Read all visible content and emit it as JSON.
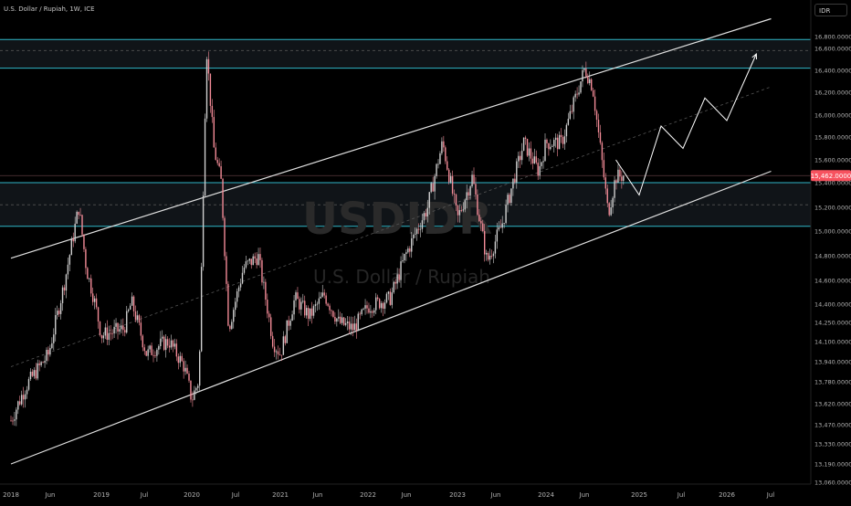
{
  "header": {
    "symbol_line": "U.S. Dollar / Rupiah, 1W, ICE",
    "currency": "IDR"
  },
  "watermark": {
    "ticker": "USDIDR",
    "name": "U.S. Dollar / Rupiah"
  },
  "price_tag": {
    "value": "15,462.0000",
    "color": "#f7525f"
  },
  "colors": {
    "up": "#cfcfcf",
    "down": "#f38b97",
    "zone_line": "#2fb6c8",
    "channel": "#e0e0e0",
    "axis_text": "#b3b3b3"
  },
  "chart_data": {
    "type": "candlestick",
    "title": "U.S. Dollar / Rupiah, 1W, ICE",
    "y_unit": "IDR",
    "y_ticks": [
      "16,800.0000",
      "16,600.0000",
      "16,400.0000",
      "16,200.0000",
      "16,000.0000",
      "15,800.0000",
      "15,600.0000",
      "15,400.0000",
      "15,200.0000",
      "15,000.0000",
      "14,800.0000",
      "14,600.0000",
      "14,400.0000",
      "14,250.0000",
      "14,100.0000",
      "13,940.0000",
      "13,780.0000",
      "13,620.0000",
      "13,470.0000",
      "13,330.0000",
      "13,190.0000",
      "13,060.0000"
    ],
    "x_ticks": [
      "2018",
      "Jun",
      "2019",
      "Jul",
      "2020",
      "Jul",
      "2021",
      "Jun",
      "2022",
      "Jun",
      "2023",
      "Jun",
      "2024",
      "Jun",
      "2025",
      "Jul",
      "2026",
      "Jul"
    ],
    "price_path": [
      [
        "2018-01",
        13500
      ],
      [
        "2018-03",
        13750
      ],
      [
        "2018-06",
        14000
      ],
      [
        "2018-08",
        14550
      ],
      [
        "2018-10",
        15200
      ],
      [
        "2018-11",
        14700
      ],
      [
        "2018-12",
        14450
      ],
      [
        "2019-01",
        14150
      ],
      [
        "2019-04",
        14200
      ],
      [
        "2019-05",
        14420
      ],
      [
        "2019-07",
        14000
      ],
      [
        "2019-09",
        14080
      ],
      [
        "2019-10",
        14100
      ],
      [
        "2019-12",
        13900
      ],
      [
        "2020-01",
        13650
      ],
      [
        "2020-02",
        13800
      ],
      [
        "2020-03",
        16600
      ],
      [
        "2020-04",
        15700
      ],
      [
        "2020-05",
        15400
      ],
      [
        "2020-06",
        14200
      ],
      [
        "2020-08",
        14700
      ],
      [
        "2020-10",
        14800
      ],
      [
        "2020-12",
        14100
      ],
      [
        "2021-01",
        14000
      ],
      [
        "2021-03",
        14450
      ],
      [
        "2021-05",
        14300
      ],
      [
        "2021-07",
        14480
      ],
      [
        "2021-09",
        14250
      ],
      [
        "2021-11",
        14200
      ],
      [
        "2022-01",
        14380
      ],
      [
        "2022-04",
        14450
      ],
      [
        "2022-06",
        14800
      ],
      [
        "2022-09",
        15200
      ],
      [
        "2022-11",
        15750
      ],
      [
        "2023-01",
        15100
      ],
      [
        "2023-03",
        15450
      ],
      [
        "2023-05",
        14750
      ],
      [
        "2023-07",
        15050
      ],
      [
        "2023-10",
        15750
      ],
      [
        "2023-12",
        15500
      ],
      [
        "2024-01",
        15750
      ],
      [
        "2024-03",
        15750
      ],
      [
        "2024-06",
        16420
      ],
      [
        "2024-07",
        16250
      ],
      [
        "2024-09",
        15150
      ],
      [
        "2024-10",
        15450
      ],
      [
        "2024-11",
        15462
      ]
    ],
    "channel": {
      "upper": [
        [
          "2018-01",
          14780
        ],
        [
          "2026-07",
          17100
        ]
      ],
      "lower": [
        [
          "2018-01",
          13190
        ],
        [
          "2026-07",
          15500
        ]
      ],
      "middle": [
        [
          "2018-01",
          13900
        ],
        [
          "2026-07",
          16250
        ]
      ]
    },
    "zones": [
      {
        "top": 16750,
        "bottom": 16420,
        "mid": 16580
      },
      {
        "top": 15400,
        "bottom": 15040,
        "mid": 15220
      }
    ],
    "projection": [
      [
        "2024-10",
        15600
      ],
      [
        "2025-01",
        15300
      ],
      [
        "2025-04",
        15900
      ],
      [
        "2025-07",
        15700
      ],
      [
        "2025-10",
        16150
      ],
      [
        "2026-01",
        15950
      ],
      [
        "2026-05",
        16550
      ]
    ],
    "last_price": 15462,
    "grid": false,
    "legend": "none"
  }
}
